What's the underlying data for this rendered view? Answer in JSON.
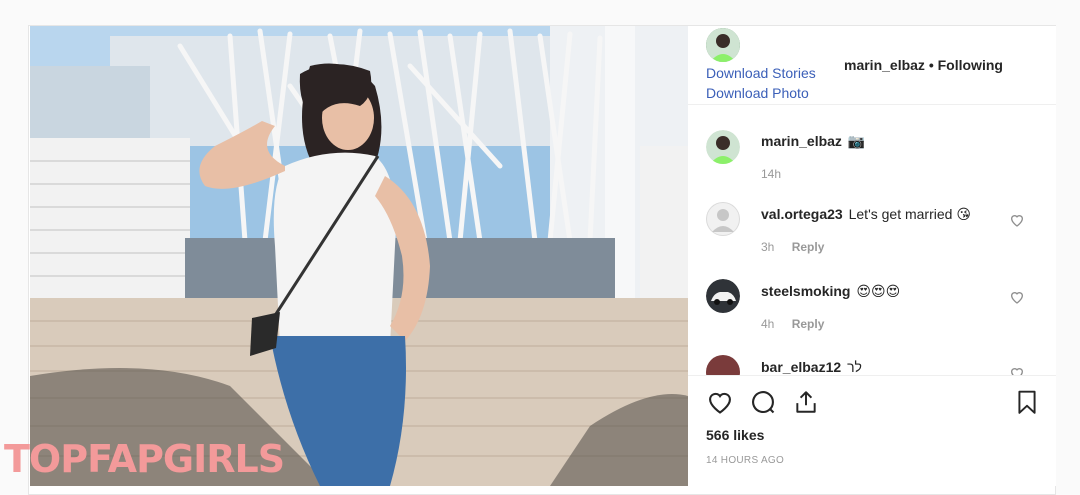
{
  "header": {
    "download_stories": "Download Stories",
    "download_photo": "Download Photo",
    "username": "marin_elbaz",
    "separator": "•",
    "follow_status": "Following"
  },
  "comments": [
    {
      "user": "marin_elbaz",
      "text": "📷",
      "time": "14h",
      "reply": "",
      "avatar_color": "#6f9c78"
    },
    {
      "user": "val.ortega23",
      "text": "Let's get married 😘",
      "time": "3h",
      "reply": "Reply",
      "avatar_color": "#d9d9d9"
    },
    {
      "user": "steelsmoking",
      "text": "😍😍😍",
      "time": "4h",
      "reply": "Reply",
      "avatar_color": "#cfcfcf"
    },
    {
      "user": "bar_elbaz12",
      "text": "לר",
      "time": "",
      "reply": "",
      "avatar_color": "#7a3b3b"
    }
  ],
  "actions": {
    "like_icon": "heart-icon",
    "comment_icon": "comment-icon",
    "share_icon": "share-icon",
    "save_icon": "bookmark-icon"
  },
  "likes": "566 likes",
  "posted": "14 HOURS AGO",
  "watermark": "TOPFAPGIRLS",
  "colors": {
    "link": "#3b5fb8",
    "meta": "#999999",
    "border": "#efefef",
    "watermark": "#f39a9a"
  }
}
